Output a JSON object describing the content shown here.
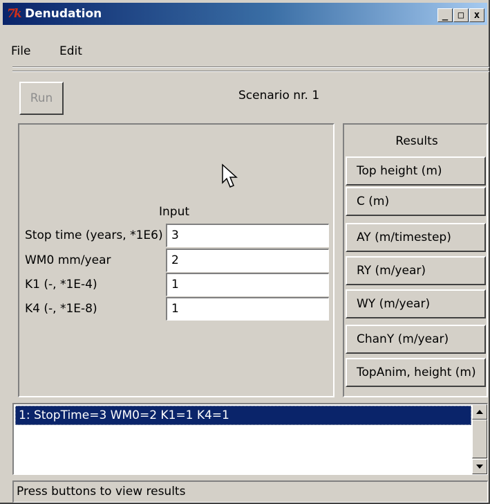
{
  "window": {
    "title": "Denudation",
    "logo_text": "7k",
    "controls": {
      "minimize": "_",
      "maximize": "□",
      "close": "x"
    }
  },
  "menu": {
    "file": "File",
    "edit": "Edit"
  },
  "toolbar": {
    "run_label": "Run",
    "scenario_text": "Scenario nr. 1"
  },
  "input": {
    "heading": "Input",
    "fields": [
      {
        "label": "Stop time (years, *1E6)",
        "value": "3"
      },
      {
        "label": "WM0 mm/year",
        "value": "2"
      },
      {
        "label": "K1 (-, *1E-4)",
        "value": "1"
      },
      {
        "label": "K4 (-, *1E-8)",
        "value": "1"
      }
    ]
  },
  "results": {
    "heading": "Results",
    "buttons": [
      "Top height (m)",
      "C (m)",
      "AY (m/timestep)",
      "RY (m/year)",
      "WY (m/year)",
      "ChanY (m/year)",
      "TopAnim, height (m)"
    ]
  },
  "scenarios": {
    "items": [
      "1: StopTime=3 WM0=2 K1=1 K4=1"
    ],
    "selected_index": 0
  },
  "status": {
    "text": "Press buttons to view results"
  },
  "colors": {
    "window_bg": "#d4d0c8",
    "title_start": "#0a246a",
    "title_end": "#a6caf0",
    "selection": "#0a246a",
    "disabled_text": "#8e8e8e"
  }
}
